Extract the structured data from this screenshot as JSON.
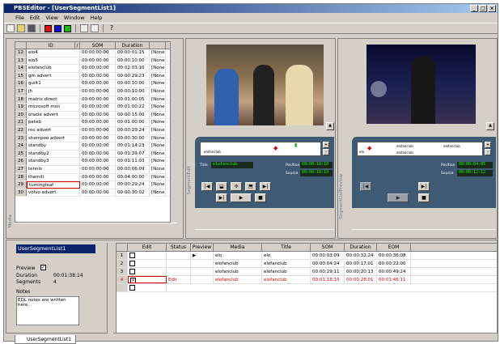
{
  "window": {
    "title": "PBSEditor - [UserSegmentList1]"
  },
  "menu": [
    "File",
    "Edit",
    "View",
    "Window",
    "Help"
  ],
  "colors": {
    "red": "#e01010",
    "blue": "#1010d0",
    "green": "#10c010",
    "titlebar": "#0a246a"
  },
  "segment_list": {
    "headers": [
      "",
      "ID",
      "/",
      "SOM",
      "Duration",
      ""
    ],
    "rows": [
      {
        "n": "12",
        "id": "elo4",
        "som": "00:00:00:00",
        "dur": "00:00:01:15",
        "x": "[None"
      },
      {
        "n": "13",
        "id": "elo5",
        "som": "00:00:00:00",
        "dur": "00:00:10:00",
        "x": "[None"
      },
      {
        "n": "14",
        "id": "elofanclub",
        "som": "00:00:00:00",
        "dur": "00:02:03:10",
        "x": "[None"
      },
      {
        "n": "15",
        "id": "gm advert",
        "som": "00:00:00:00",
        "dur": "00:00:29:23",
        "x": "[None"
      },
      {
        "n": "16",
        "id": "guilt1",
        "som": "00:00:00:00",
        "dur": "00:00:10:00",
        "x": "[None"
      },
      {
        "n": "17",
        "id": "jh",
        "som": "00:00:00:00",
        "dur": "00:00:10:00",
        "x": "[None"
      },
      {
        "n": "18",
        "id": "matrix direct",
        "som": "00:00:00:00",
        "dur": "00:01:00:05",
        "x": "[None"
      },
      {
        "n": "19",
        "id": "microsoft msn",
        "som": "00:00:00:00",
        "dur": "00:01:00:22",
        "x": "[None"
      },
      {
        "n": "20",
        "id": "oracle advert",
        "som": "00:00:00:00",
        "dur": "00:00:15:00",
        "x": "[None"
      },
      {
        "n": "21",
        "id": "peteb",
        "som": "00:00:00:00",
        "dur": "00:01:00:00",
        "x": "[None"
      },
      {
        "n": "22",
        "id": "roc advert",
        "som": "00:00:00:00",
        "dur": "00:00:29:24",
        "x": "[None"
      },
      {
        "n": "23",
        "id": "shampoo advert",
        "som": "00:00:00:00",
        "dur": "00:00:30:00",
        "x": "[None"
      },
      {
        "n": "24",
        "id": "standby",
        "som": "00:00:00:00",
        "dur": "00:01:14:23",
        "x": "[None"
      },
      {
        "n": "25",
        "id": "standby2",
        "som": "00:00:00:00",
        "dur": "00:01:39:07",
        "x": "[None"
      },
      {
        "n": "26",
        "id": "standby3",
        "som": "00:00:00:00",
        "dur": "00:01:11:03",
        "x": "[None"
      },
      {
        "n": "27",
        "id": "tennis",
        "som": "00:00:00:00",
        "dur": "00:00:06:09",
        "x": "[None"
      },
      {
        "n": "28",
        "id": "themill",
        "som": "00:00:00:00",
        "dur": "00:04:00:00",
        "x": "[None"
      },
      {
        "n": "29",
        "id": "turningleaf",
        "som": "00:00:00:00",
        "dur": "00:00:29:24",
        "x": "[None"
      },
      {
        "n": "30",
        "id": "volvo advert",
        "som": "00:00:00:00",
        "dur": "00:00:30:02",
        "x": "[None"
      }
    ],
    "side_label": "Media"
  },
  "segment_edit": {
    "timeline_text": "elofanclub",
    "title_label": "Title",
    "title_value": "elofanclub",
    "position_label": "Position",
    "position_value": "00:00:18:10",
    "source_label": "Source",
    "source_value": "00:00:18:10",
    "side_label": "SegmentEdit"
  },
  "preview": {
    "timeline_texts": [
      "elo",
      "elofanclub",
      "elofanclub",
      "elofanclub"
    ],
    "position_label": "Position",
    "position_value": "00:00:04:05",
    "source_label": "Source",
    "source_value": "00:00:12:12",
    "side_label": "SegmentListPreview"
  },
  "properties": {
    "list_name": "UserSegmentList1",
    "preview_label": "Preview",
    "duration_label": "Duration",
    "duration_value": "00:01:38:14",
    "segments_label": "Segments",
    "segments_value": "4",
    "notes_label": "Notes",
    "notes_text": "EDL notes are written here."
  },
  "edl": {
    "headers": [
      "",
      "Edit",
      "Status",
      "Preview",
      "Media",
      "Title",
      "SOM",
      "Duration",
      "EOM"
    ],
    "rows": [
      {
        "n": "1",
        "status": "",
        "preview": "▶",
        "media": "elo",
        "title": "elo",
        "som": "00:00:03:09",
        "dur": "00:00:32:24",
        "eom": "00:00:36:08",
        "red": false
      },
      {
        "n": "2",
        "status": "",
        "preview": "",
        "media": "elofanclub",
        "title": "elofanclub",
        "som": "00:00:04:24",
        "dur": "00:00:17:01",
        "eom": "00:00:22:00",
        "red": false
      },
      {
        "n": "3",
        "status": "",
        "preview": "",
        "media": "elofanclub",
        "title": "elofanclub",
        "som": "00:00:29:11",
        "dur": "00:00:20:13",
        "eom": "00:00:49:24",
        "red": false
      },
      {
        "n": "4",
        "status": "Edit",
        "preview": "",
        "media": "elofanclub",
        "title": "elofanclub",
        "som": "00:01:18:10",
        "dur": "00:00:28:01",
        "eom": "00:01:46:11",
        "red": true
      }
    ]
  },
  "tab": {
    "label": "UserSegmentList1"
  }
}
